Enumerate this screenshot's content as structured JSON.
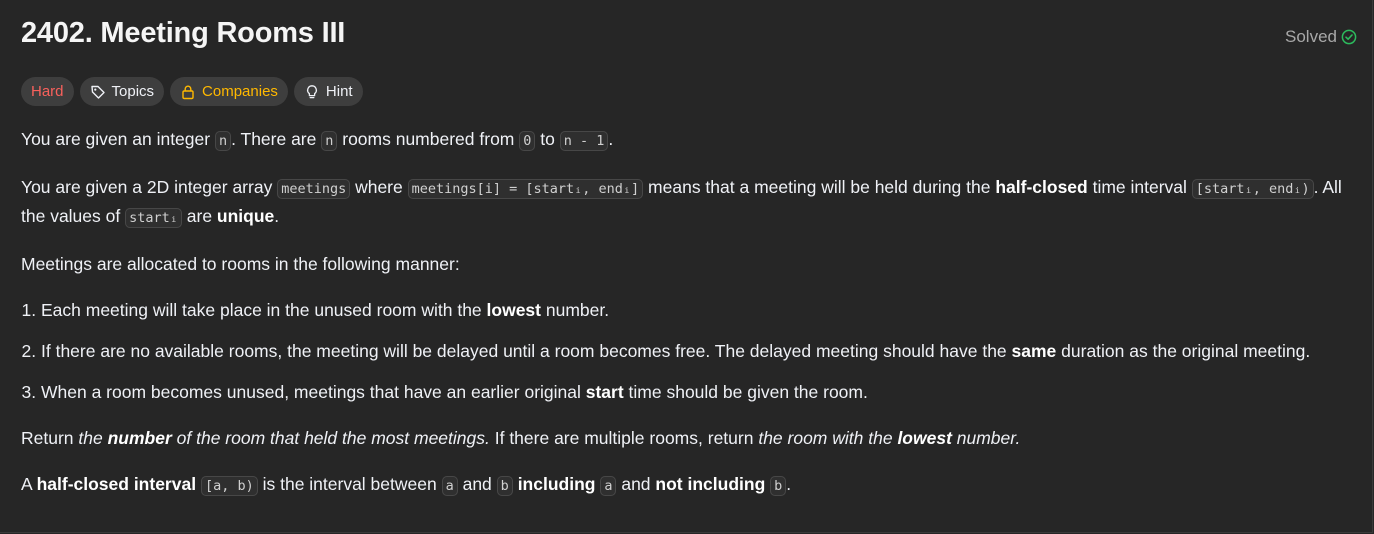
{
  "problem": {
    "title": "2402. Meeting Rooms III",
    "status": "Solved"
  },
  "tags": {
    "difficulty": "Hard",
    "topics": "Topics",
    "companies": "Companies",
    "hint": "Hint"
  },
  "description": {
    "p1": {
      "t1": "You are given an integer ",
      "c1": "n",
      "t2": ". There are ",
      "c2": "n",
      "t3": " rooms numbered from ",
      "c3": "0",
      "t4": " to ",
      "c4": "n - 1",
      "t5": "."
    },
    "p2": {
      "t1": "You are given a 2D integer array ",
      "c1": "meetings",
      "t2": " where ",
      "c2": "meetings[i] = [startᵢ, endᵢ]",
      "t3": " means that a meeting will be held during the ",
      "b1": "half-closed",
      "t4": " time interval ",
      "c3": "[startᵢ, endᵢ)",
      "t5": ". All the values of ",
      "c4": "startᵢ",
      "t6": " are ",
      "b2": "unique",
      "t7": "."
    },
    "p3": "Meetings are allocated to rooms in the following manner:",
    "rules": {
      "r1": {
        "t1": "Each meeting will take place in the unused room with the ",
        "b1": "lowest",
        "t2": " number."
      },
      "r2": {
        "t1": "If there are no available rooms, the meeting will be delayed until a room becomes free. The delayed meeting should have the ",
        "b1": "same",
        "t2": " duration as the original meeting."
      },
      "r3": {
        "t1": "When a room becomes unused, meetings that have an earlier original ",
        "b1": "start",
        "t2": " time should be given the room."
      }
    },
    "p4": {
      "t1": "Return ",
      "i1": "the ",
      "ib1": "number",
      "i2": " of the room that held the most meetings.",
      "t2": " If there are multiple rooms, return ",
      "i3": "the room with the ",
      "ib2": "lowest",
      "i4": " number."
    },
    "p5": {
      "t1": "A ",
      "b1": "half-closed interval",
      "t2": " ",
      "c1": "[a, b)",
      "t3": " is the interval between ",
      "c2": "a",
      "t4": " and ",
      "c3": "b",
      "t5": " ",
      "b2": "including",
      "t6": " ",
      "c4": "a",
      "t7": " and ",
      "b3": "not including",
      "t8": " ",
      "c5": "b",
      "t9": "."
    }
  },
  "colors": {
    "background": "#262626",
    "hard": "#f8615c",
    "companies": "#ffb800",
    "solved_check": "#2cbb5d"
  },
  "icons": {
    "solved": "check-circle-icon",
    "topics": "tag-icon",
    "companies": "lock-icon",
    "hint": "lightbulb-icon"
  }
}
